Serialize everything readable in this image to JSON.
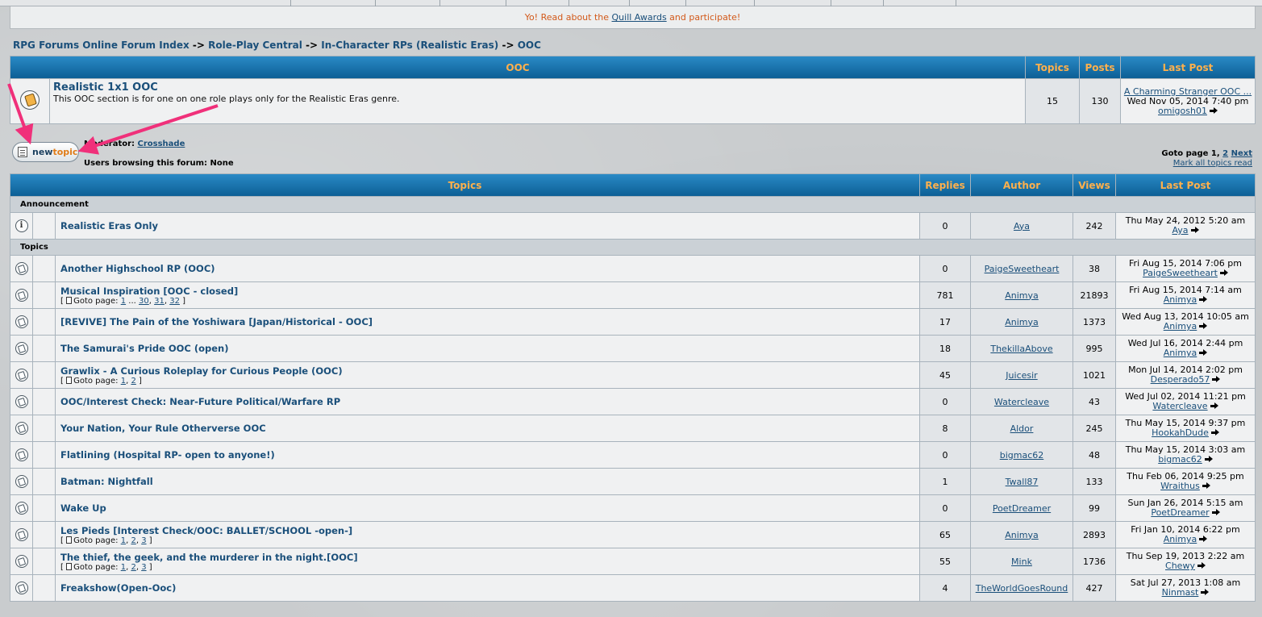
{
  "notice": {
    "prefix": "Yo! Read about the",
    "link": "Quill Awards",
    "suffix": "and participate!"
  },
  "breadcrumb": [
    {
      "label": "RPG Forums Online Forum Index"
    },
    {
      "label": "Role-Play Central"
    },
    {
      "label": "In-Character RPs (Realistic Eras)"
    },
    {
      "label": "OOC"
    }
  ],
  "breadcrumb_sep": "->",
  "forum_table": {
    "headers": {
      "forum": "OOC",
      "topics": "Topics",
      "posts": "Posts",
      "last_post": "Last Post"
    },
    "row": {
      "title": "Realistic 1x1 OOC",
      "description": "This OOC section is for one on one role plays only for the Realistic Eras genre.",
      "topics": "15",
      "posts": "130",
      "last_post_title": "A Charming Stranger OOC ...",
      "last_post_date": "Wed Nov 05, 2014 7:40 pm",
      "last_post_user": "omigosh01"
    }
  },
  "new_topic": {
    "part1": "new",
    "part2": "topic"
  },
  "moderator": {
    "label": "Moderator:",
    "name": "Crosshade"
  },
  "browsing": "Users browsing this forum: None",
  "pagination": {
    "prefix": "Goto page",
    "current": "1,",
    "page2": "2",
    "next": "Next"
  },
  "mark_read": "Mark all topics read",
  "topics_table": {
    "headers": {
      "topics": "Topics",
      "replies": "Replies",
      "author": "Author",
      "views": "Views",
      "last_post": "Last Post"
    },
    "section_announcement": "Announcement",
    "section_topics": "Topics",
    "goto_label": "Goto page:",
    "announcements": [
      {
        "title": "Realistic Eras Only",
        "replies": "0",
        "author": "Aya",
        "views": "242",
        "date": "Thu May 24, 2012 5:20 am",
        "last_user": "Aya"
      }
    ],
    "topics": [
      {
        "title": "Another Highschool RP (OOC)",
        "replies": "0",
        "author": "PaigeSweetheart",
        "views": "38",
        "date": "Fri Aug 15, 2014 7:06 pm",
        "last_user": "PaigeSweetheart"
      },
      {
        "title": "Musical Inspiration [OOC - closed]",
        "pages": [
          "1",
          "...",
          "30",
          "31",
          "32"
        ],
        "replies": "781",
        "author": "Animya",
        "views": "21893",
        "date": "Fri Aug 15, 2014 7:14 am",
        "last_user": "Animya"
      },
      {
        "title": "[REVIVE] The Pain of the Yoshiwara [Japan/Historical - OOC]",
        "replies": "17",
        "author": "Animya",
        "views": "1373",
        "date": "Wed Aug 13, 2014 10:05 am",
        "last_user": "Animya"
      },
      {
        "title": "The Samurai's Pride OOC (open)",
        "replies": "18",
        "author": "ThekillaAbove",
        "views": "995",
        "date": "Wed Jul 16, 2014 2:44 pm",
        "last_user": "Animya"
      },
      {
        "title": "Grawlix - A Curious Roleplay for Curious People (OOC)",
        "pages": [
          "1",
          "2"
        ],
        "replies": "45",
        "author": "Juicesir",
        "views": "1021",
        "date": "Mon Jul 14, 2014 2:02 pm",
        "last_user": "Desperado57"
      },
      {
        "title": "OOC/Interest Check: Near-Future Political/Warfare RP",
        "replies": "0",
        "author": "Watercleave",
        "views": "43",
        "date": "Wed Jul 02, 2014 11:21 pm",
        "last_user": "Watercleave"
      },
      {
        "title": "Your Nation, Your Rule Otherverse OOC",
        "replies": "8",
        "author": "Aldor",
        "views": "245",
        "date": "Thu May 15, 2014 9:37 pm",
        "last_user": "HookahDude"
      },
      {
        "title": "Flatlining (Hospital RP- open to anyone!)",
        "replies": "0",
        "author": "bigmac62",
        "views": "48",
        "date": "Thu May 15, 2014 3:03 am",
        "last_user": "bigmac62"
      },
      {
        "title": "Batman: Nightfall",
        "replies": "1",
        "author": "Twall87",
        "views": "133",
        "date": "Thu Feb 06, 2014 9:25 pm",
        "last_user": "Wraithus"
      },
      {
        "title": "Wake Up",
        "replies": "0",
        "author": "PoetDreamer",
        "views": "99",
        "date": "Sun Jan 26, 2014 5:15 am",
        "last_user": "PoetDreamer"
      },
      {
        "title": "Les Pieds [Interest Check/OOC: BALLET/SCHOOL -open-]",
        "pages": [
          "1",
          "2",
          "3"
        ],
        "replies": "65",
        "author": "Animya",
        "views": "2893",
        "date": "Fri Jan 10, 2014 6:22 pm",
        "last_user": "Animya"
      },
      {
        "title": "The thief, the geek, and the murderer in the night.[OOC]",
        "pages": [
          "1",
          "2",
          "3"
        ],
        "replies": "55",
        "author": "Mink",
        "views": "1736",
        "date": "Thu Sep 19, 2013 2:22 am",
        "last_user": "Chewy"
      },
      {
        "title": "Freakshow(Open-Ooc)",
        "replies": "4",
        "author": "TheWorldGoesRound",
        "views": "427",
        "date": "Sat Jul 27, 2013 1:08 am",
        "last_user": "Ninmast"
      }
    ]
  },
  "colors": {
    "header_bg": "#1a6fa8",
    "header_text": "#ffb04c",
    "link": "#1a4f7a",
    "notice_text": "#d2591a",
    "annotation_arrow": "#f0307a"
  },
  "icons": {
    "folder": "folder-icon",
    "topic": "topic-icon",
    "announcement": "info-icon",
    "last_post": "arrow-right-icon",
    "new_topic": "new-topic-icon"
  }
}
